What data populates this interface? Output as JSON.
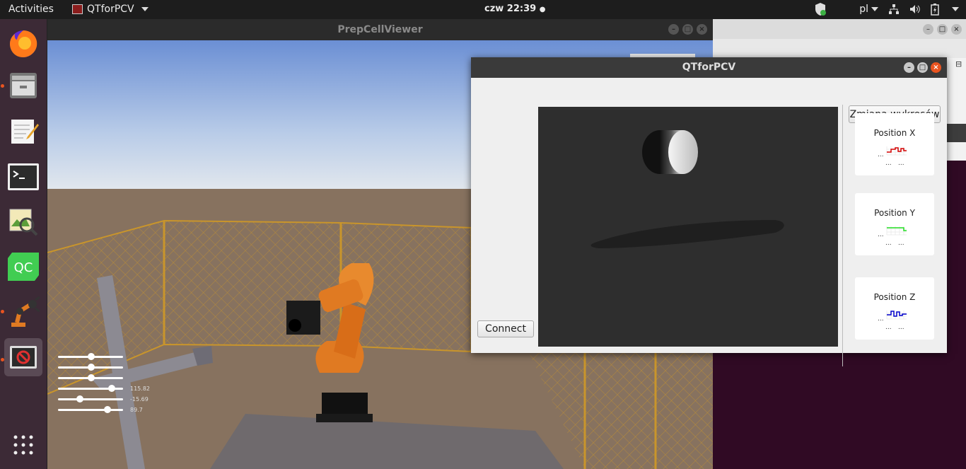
{
  "topbar": {
    "activities": "Activities",
    "app_name": "QTforPCV",
    "clock": "czw 22:39",
    "language": "pl"
  },
  "dock": {
    "items": [
      "firefox-icon",
      "files-icon",
      "text-editor-icon",
      "terminal-icon",
      "image-viewer-icon",
      "qt-creator-icon",
      "robot-app-icon",
      "prepcellviewer-icon"
    ],
    "apps_grid": "show-applications-icon"
  },
  "prep_window": {
    "title": "PrepCellViewer",
    "slider_values": [
      "115.82",
      "-15.69",
      "89.7"
    ]
  },
  "qt_window": {
    "title": "QTforPCV",
    "connect_label": "Connect",
    "zmiana_label": "Zmiana wykresów",
    "charts": [
      {
        "label": "Position X",
        "color": "#d40000",
        "x_ticks": [
          "...",
          "..."
        ],
        "y_tick": "..."
      },
      {
        "label": "Position Y",
        "color": "#22dd22",
        "x_ticks": [
          "...",
          "..."
        ],
        "y_tick": "..."
      },
      {
        "label": "Position Z",
        "color": "#0000cc",
        "x_ticks": [
          "...",
          "..."
        ],
        "y_tick": "..."
      }
    ]
  },
  "colors": {
    "accent": "#e95420",
    "sky_top": "#6e93d6",
    "ground": "#86715f",
    "robot": "#e07a22"
  }
}
